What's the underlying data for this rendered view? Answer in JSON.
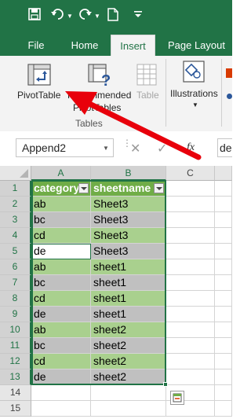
{
  "tabs": [
    {
      "label": "File"
    },
    {
      "label": "Home"
    },
    {
      "label": "Insert"
    },
    {
      "label": "Page Layout"
    }
  ],
  "ribbon": {
    "pivottable_label": "PivotTable",
    "recommended_line1": "Recommended",
    "recommended_line2": "PivotTables",
    "table_label": "Table",
    "illustrations_label": "Illustrations",
    "group_tables": "Tables"
  },
  "formula_bar": {
    "name_box": "Append2",
    "fx_symbol": "fx",
    "formula_value": "de"
  },
  "columns": [
    "A",
    "B",
    "C"
  ],
  "table_headers": [
    "category",
    "sheetname"
  ],
  "rows": [
    {
      "num": "1"
    },
    {
      "num": "2",
      "a": "ab",
      "b": "Sheet3"
    },
    {
      "num": "3",
      "a": "bc",
      "b": "Sheet3"
    },
    {
      "num": "4",
      "a": "cd",
      "b": "Sheet3"
    },
    {
      "num": "5",
      "a": "de",
      "b": "Sheet3"
    },
    {
      "num": "6",
      "a": "ab",
      "b": "sheet1"
    },
    {
      "num": "7",
      "a": "bc",
      "b": "sheet1"
    },
    {
      "num": "8",
      "a": "cd",
      "b": "sheet1"
    },
    {
      "num": "9",
      "a": "de",
      "b": "sheet1"
    },
    {
      "num": "10",
      "a": "ab",
      "b": "sheet2"
    },
    {
      "num": "11",
      "a": "bc",
      "b": "sheet2"
    },
    {
      "num": "12",
      "a": "cd",
      "b": "sheet2"
    },
    {
      "num": "13",
      "a": "de",
      "b": "sheet2"
    },
    {
      "num": "14"
    },
    {
      "num": "15"
    }
  ],
  "colors": {
    "brand_green": "#217346",
    "table_header": "#70ad47",
    "band_light": "#a9d08e",
    "selection_grey": "#c0c0c0",
    "arrow_red": "#e8000b"
  }
}
